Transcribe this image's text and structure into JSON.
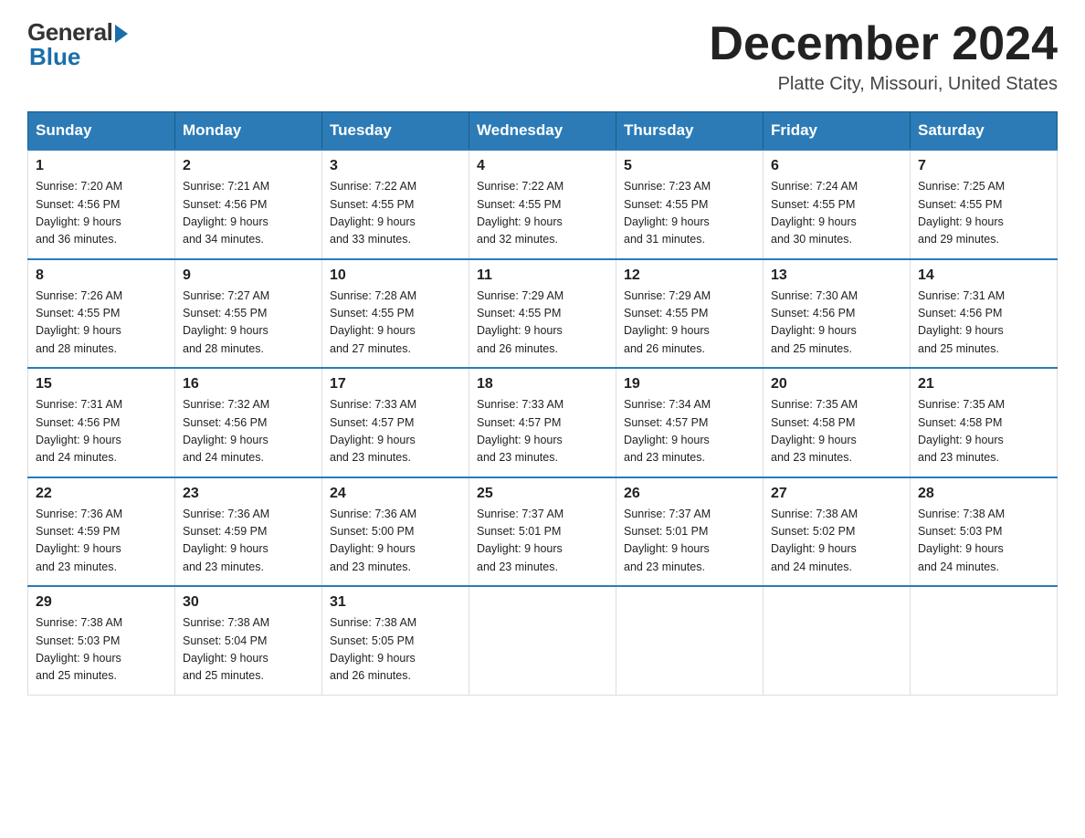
{
  "logo": {
    "general": "General",
    "blue": "Blue"
  },
  "title": {
    "month_year": "December 2024",
    "location": "Platte City, Missouri, United States"
  },
  "weekdays": [
    "Sunday",
    "Monday",
    "Tuesday",
    "Wednesday",
    "Thursday",
    "Friday",
    "Saturday"
  ],
  "weeks": [
    [
      {
        "day": "1",
        "sunrise": "7:20 AM",
        "sunset": "4:56 PM",
        "daylight": "9 hours and 36 minutes."
      },
      {
        "day": "2",
        "sunrise": "7:21 AM",
        "sunset": "4:56 PM",
        "daylight": "9 hours and 34 minutes."
      },
      {
        "day": "3",
        "sunrise": "7:22 AM",
        "sunset": "4:55 PM",
        "daylight": "9 hours and 33 minutes."
      },
      {
        "day": "4",
        "sunrise": "7:22 AM",
        "sunset": "4:55 PM",
        "daylight": "9 hours and 32 minutes."
      },
      {
        "day": "5",
        "sunrise": "7:23 AM",
        "sunset": "4:55 PM",
        "daylight": "9 hours and 31 minutes."
      },
      {
        "day": "6",
        "sunrise": "7:24 AM",
        "sunset": "4:55 PM",
        "daylight": "9 hours and 30 minutes."
      },
      {
        "day": "7",
        "sunrise": "7:25 AM",
        "sunset": "4:55 PM",
        "daylight": "9 hours and 29 minutes."
      }
    ],
    [
      {
        "day": "8",
        "sunrise": "7:26 AM",
        "sunset": "4:55 PM",
        "daylight": "9 hours and 28 minutes."
      },
      {
        "day": "9",
        "sunrise": "7:27 AM",
        "sunset": "4:55 PM",
        "daylight": "9 hours and 28 minutes."
      },
      {
        "day": "10",
        "sunrise": "7:28 AM",
        "sunset": "4:55 PM",
        "daylight": "9 hours and 27 minutes."
      },
      {
        "day": "11",
        "sunrise": "7:29 AM",
        "sunset": "4:55 PM",
        "daylight": "9 hours and 26 minutes."
      },
      {
        "day": "12",
        "sunrise": "7:29 AM",
        "sunset": "4:55 PM",
        "daylight": "9 hours and 26 minutes."
      },
      {
        "day": "13",
        "sunrise": "7:30 AM",
        "sunset": "4:56 PM",
        "daylight": "9 hours and 25 minutes."
      },
      {
        "day": "14",
        "sunrise": "7:31 AM",
        "sunset": "4:56 PM",
        "daylight": "9 hours and 25 minutes."
      }
    ],
    [
      {
        "day": "15",
        "sunrise": "7:31 AM",
        "sunset": "4:56 PM",
        "daylight": "9 hours and 24 minutes."
      },
      {
        "day": "16",
        "sunrise": "7:32 AM",
        "sunset": "4:56 PM",
        "daylight": "9 hours and 24 minutes."
      },
      {
        "day": "17",
        "sunrise": "7:33 AM",
        "sunset": "4:57 PM",
        "daylight": "9 hours and 23 minutes."
      },
      {
        "day": "18",
        "sunrise": "7:33 AM",
        "sunset": "4:57 PM",
        "daylight": "9 hours and 23 minutes."
      },
      {
        "day": "19",
        "sunrise": "7:34 AM",
        "sunset": "4:57 PM",
        "daylight": "9 hours and 23 minutes."
      },
      {
        "day": "20",
        "sunrise": "7:35 AM",
        "sunset": "4:58 PM",
        "daylight": "9 hours and 23 minutes."
      },
      {
        "day": "21",
        "sunrise": "7:35 AM",
        "sunset": "4:58 PM",
        "daylight": "9 hours and 23 minutes."
      }
    ],
    [
      {
        "day": "22",
        "sunrise": "7:36 AM",
        "sunset": "4:59 PM",
        "daylight": "9 hours and 23 minutes."
      },
      {
        "day": "23",
        "sunrise": "7:36 AM",
        "sunset": "4:59 PM",
        "daylight": "9 hours and 23 minutes."
      },
      {
        "day": "24",
        "sunrise": "7:36 AM",
        "sunset": "5:00 PM",
        "daylight": "9 hours and 23 minutes."
      },
      {
        "day": "25",
        "sunrise": "7:37 AM",
        "sunset": "5:01 PM",
        "daylight": "9 hours and 23 minutes."
      },
      {
        "day": "26",
        "sunrise": "7:37 AM",
        "sunset": "5:01 PM",
        "daylight": "9 hours and 23 minutes."
      },
      {
        "day": "27",
        "sunrise": "7:38 AM",
        "sunset": "5:02 PM",
        "daylight": "9 hours and 24 minutes."
      },
      {
        "day": "28",
        "sunrise": "7:38 AM",
        "sunset": "5:03 PM",
        "daylight": "9 hours and 24 minutes."
      }
    ],
    [
      {
        "day": "29",
        "sunrise": "7:38 AM",
        "sunset": "5:03 PM",
        "daylight": "9 hours and 25 minutes."
      },
      {
        "day": "30",
        "sunrise": "7:38 AM",
        "sunset": "5:04 PM",
        "daylight": "9 hours and 25 minutes."
      },
      {
        "day": "31",
        "sunrise": "7:38 AM",
        "sunset": "5:05 PM",
        "daylight": "9 hours and 26 minutes."
      },
      null,
      null,
      null,
      null
    ]
  ],
  "labels": {
    "sunrise_prefix": "Sunrise: ",
    "sunset_prefix": "Sunset: ",
    "daylight_prefix": "Daylight: "
  }
}
